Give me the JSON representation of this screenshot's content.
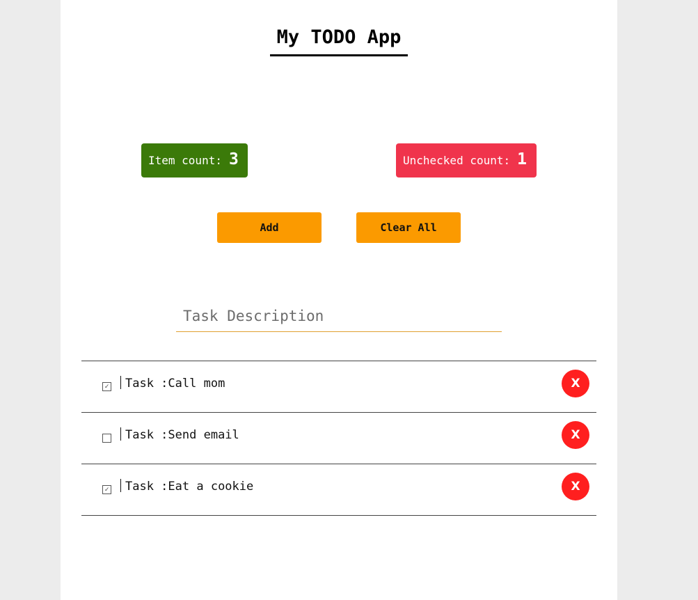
{
  "header": {
    "title": "My TODO App"
  },
  "counters": {
    "item_count_label": "Item count:",
    "item_count": "3",
    "unchecked_label": "Unchecked count:",
    "unchecked_count": "1",
    "item_count_color": "#3b7a09",
    "unchecked_color": "#f0344c"
  },
  "actions": {
    "add_label": "Add",
    "clear_label": "Clear All",
    "button_color": "#fb9a00"
  },
  "input": {
    "placeholder": "Task Description",
    "value": ""
  },
  "tasks": [
    {
      "prefix": "Task :",
      "text": "Call mom",
      "checked": true,
      "delete_label": "X"
    },
    {
      "prefix": "Task :",
      "text": "Send email",
      "checked": false,
      "delete_label": "X"
    },
    {
      "prefix": "Task :",
      "text": "Eat a cookie",
      "checked": true,
      "delete_label": "X"
    }
  ]
}
